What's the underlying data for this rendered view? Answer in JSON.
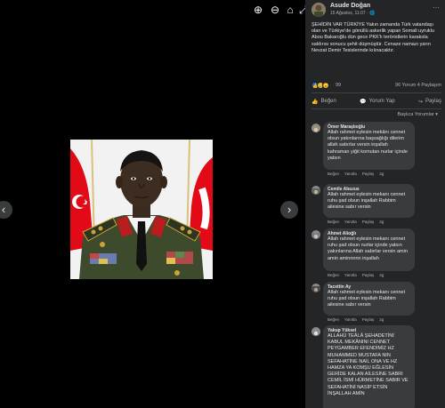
{
  "viewer": {
    "icons": [
      "zoom-in-icon",
      "zoom-out-icon",
      "tag-icon",
      "fullscreen-icon"
    ],
    "next_icon": "›",
    "prev_icon": "‹"
  },
  "post": {
    "author": "Asude Doğan",
    "date": "15 Ağustos, 11:07 · 🌐",
    "more": "···",
    "text": "ŞEHİDİN VAR TÜRKİYE Yakın zamanda Türk vatandaşı olan ve Türkiye'de gönüllü askerlik yapan Somali uyruklu Abou Bakaroğlu dün gece PKK'lı teröristlerin karakola saldırısı sonucu şehit düşmüştür. Cenaze namazı yarın Nevzat Demir Tesislerinde kılınacaktır.",
    "reaction_count": "99",
    "comments_shares": "96 Yorum  4 Paylaşım",
    "actions": {
      "like": "Beğen",
      "comment": "Yorum Yap",
      "share": "Paylaş"
    },
    "sort_label": "Başlıca Yorumlar ▾"
  },
  "comments": [
    {
      "name": "Ömer Maraşlıoğlu",
      "text": "Allah rahmet eylesin mekânı cennet olsun yakınlarına başsağlığı dilerim allah sabırlar versin inşallah kahraman yiğit komutan nurlar içinde yatsın",
      "like": "Beğen",
      "reply": "Yanıtla",
      "share": "Paylaş",
      "time": "2g"
    },
    {
      "name": "Cemile Abuzus",
      "text": "Allah rahmet eylesin mekanı cennet ruhu şad olsun inşallah Rabbim ailesine sabır versin",
      "like": "Beğen",
      "reply": "Yanıtla",
      "share": "Paylaş",
      "time": "2g"
    },
    {
      "name": "Ahmet Alioğlı",
      "text": "Allah rahmet eylesin mekanı cennet ruhu şad olsun nurlar içinde yatsın yakınlarına Allah sabırlar versin amin amin aminnnnn inşallah",
      "like": "Beğen",
      "reply": "Yanıtla",
      "share": "Paylaş",
      "time": "2g"
    },
    {
      "name": "Tacettin Ay",
      "text": "Allah rahmet eylesin mekanı cennet ruhu şad olsun inşallah Rabbim ailesine sabır versin",
      "like": "Beğen",
      "reply": "Yanıtla",
      "share": "Paylaş",
      "time": "2g"
    },
    {
      "name": "Yakup Yüksel",
      "text": "ALLAHÜ TEÂLÂ ŞEHADETİNİ KABUL MEKÂNINI CENNET PEYGAMBER EFENDİMİZ HZ MUHAMMED MUSTAFA NIN SEFAHATİNE NAİL ONA VE HZ HAMZA YA KOMŞU EĞLESİN GERİDE KALAN AİLESİNE SABRI CEMİL İSMİ HÜRMETİNE SABIR VE SEFAHATİNİ NASİP ETSİN İNŞALLAH AMİN"
    }
  ],
  "colors": {
    "panel_bg": "#242526",
    "bubble_bg": "#3a3b3c",
    "text": "#e4e6eb",
    "muted": "#b0b3b8",
    "flag_red": "#e30a17",
    "uniform_green": "#3e4a2c"
  }
}
